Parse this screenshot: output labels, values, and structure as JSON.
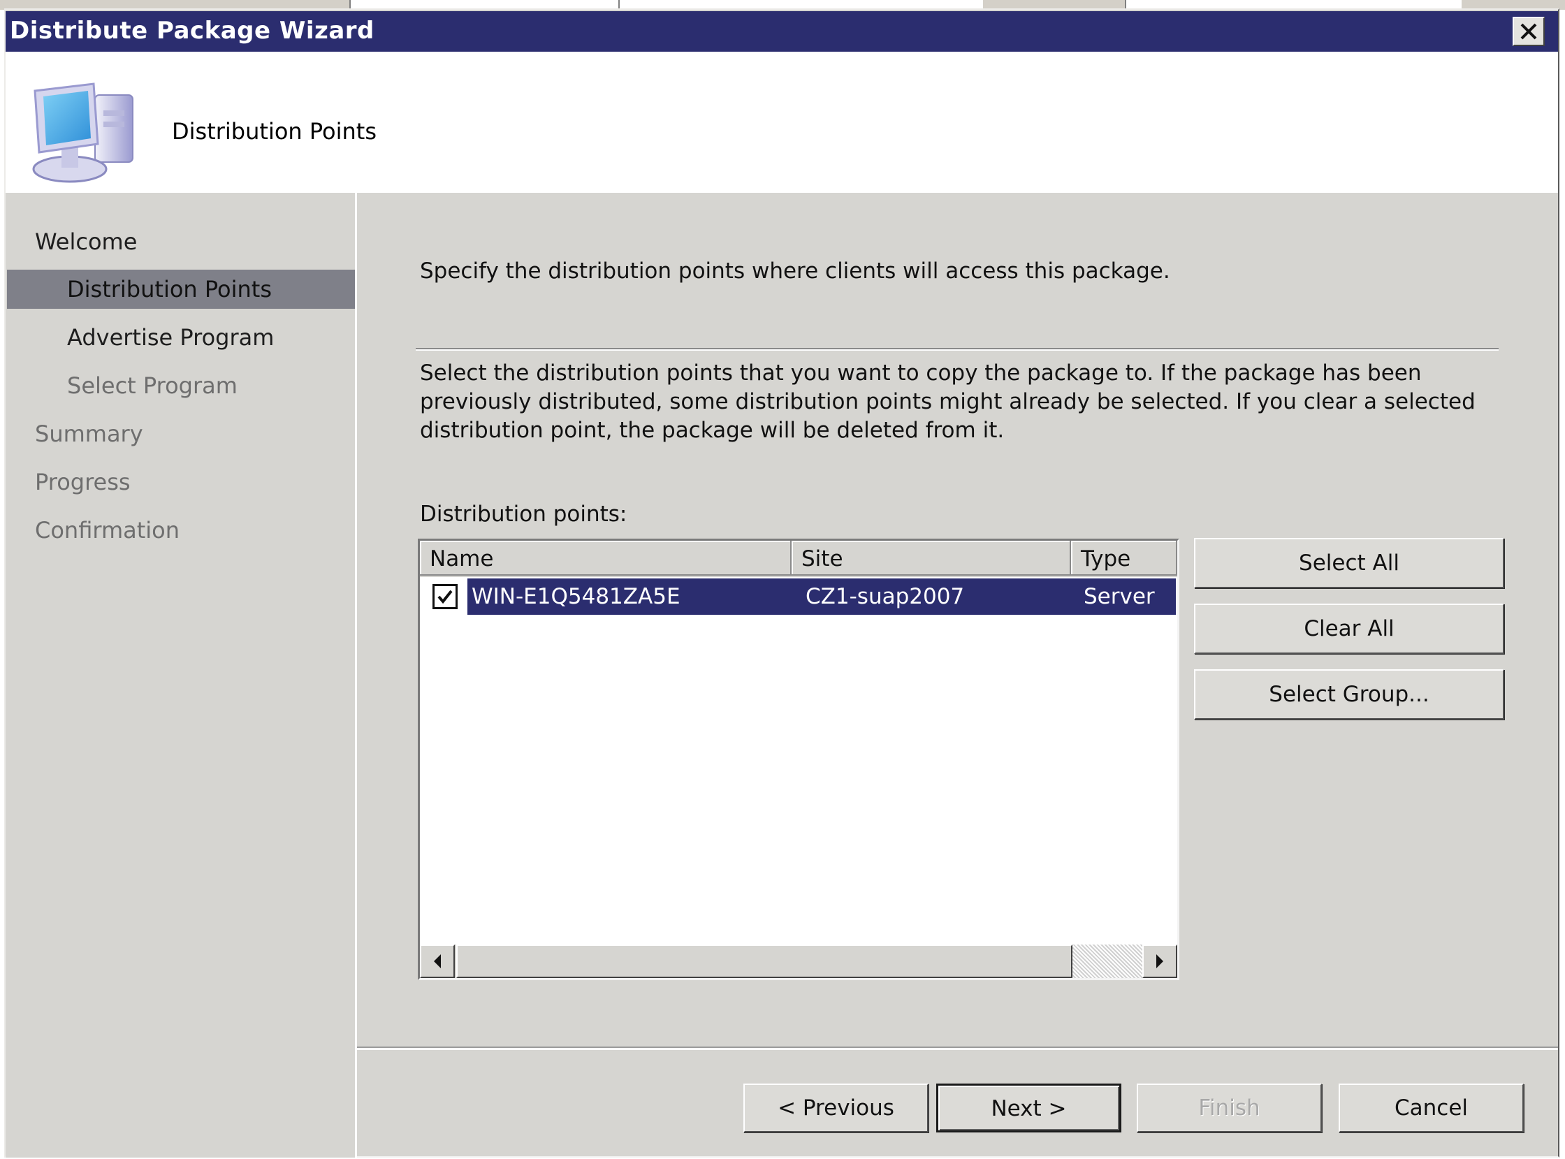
{
  "window": {
    "title": "Distribute Package Wizard",
    "close_icon": "close-icon"
  },
  "header": {
    "icon": "computer-icon",
    "title": "Distribution Points"
  },
  "nav": {
    "items": [
      {
        "label": "Welcome",
        "state": "completed"
      },
      {
        "label": "Distribution Points",
        "state": "active"
      },
      {
        "label": "Advertise Program",
        "state": "enabled"
      },
      {
        "label": "Select Program",
        "state": "disabled"
      },
      {
        "label": "Summary",
        "state": "disabled"
      },
      {
        "label": "Progress",
        "state": "disabled"
      },
      {
        "label": "Confirmation",
        "state": "disabled"
      }
    ]
  },
  "content": {
    "intro": "Specify the distribution points where clients will access this package.",
    "description": "Select the distribution points that you want to copy the package to. If the package has been previously distributed, some distribution points might already be selected. If you clear a selected distribution point, the package will be deleted from it.",
    "list_label": "Distribution points:",
    "list": {
      "columns": [
        "Name",
        "Site",
        "Type"
      ],
      "rows": [
        {
          "checked": true,
          "selected": true,
          "name": "WIN-E1Q5481ZA5E",
          "site": "CZ1-suap2007",
          "type": "Server"
        }
      ]
    },
    "buttons": {
      "select_all": "Select All",
      "clear_all": "Clear All",
      "select_group": "Select Group..."
    }
  },
  "footer": {
    "previous": "< Previous",
    "next": "Next >",
    "finish": "Finish",
    "cancel": "Cancel"
  },
  "colors": {
    "titlebar": "#2b2d6f",
    "selection": "#2b2d6f",
    "nav_active": "#7f8089",
    "dialog_bg": "#d6d5d1"
  }
}
